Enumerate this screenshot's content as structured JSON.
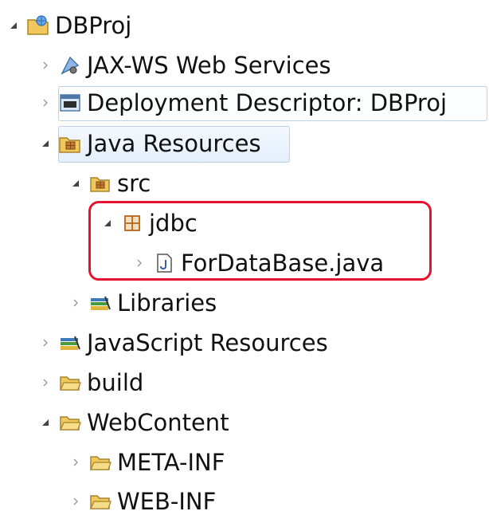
{
  "tree": {
    "project": {
      "label": "DBProj",
      "expanded": true
    },
    "items": {
      "jaxws": {
        "label": "JAX-WS Web Services"
      },
      "deployment": {
        "label": "Deployment Descriptor: DBProj"
      },
      "java_resources": {
        "label": "Java Resources",
        "expanded": true
      },
      "src": {
        "label": "src",
        "expanded": true
      },
      "jdbc": {
        "label": "jdbc",
        "expanded": true
      },
      "fordatabase": {
        "label": "ForDataBase.java"
      },
      "libraries": {
        "label": "Libraries"
      },
      "javascript_resources": {
        "label": "JavaScript Resources"
      },
      "build": {
        "label": "build"
      },
      "webcontent": {
        "label": "WebContent",
        "expanded": true
      },
      "meta_inf": {
        "label": "META-INF"
      },
      "web_inf": {
        "label": "WEB-INF"
      }
    }
  },
  "colors": {
    "highlight": "#e5132d",
    "selection_border": "#b8d0ea",
    "folder": "#e8c15a",
    "package": "#b5651d"
  }
}
